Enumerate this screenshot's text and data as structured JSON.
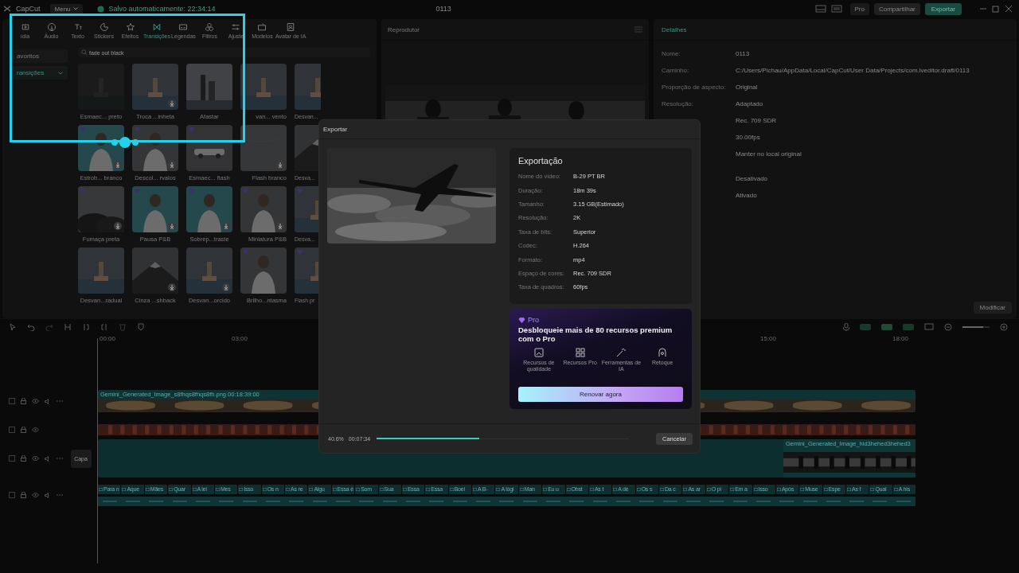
{
  "app": {
    "logo": "CapCut",
    "menu": "Menu",
    "autosave": "Salvo automaticamente: 22:34:14",
    "title": "0113",
    "pro": "Pro",
    "share": "Compartilhar",
    "export": "Exportar"
  },
  "media": {
    "tabs": [
      {
        "label": "ídia",
        "selected": false
      },
      {
        "label": "Áudio",
        "selected": false
      },
      {
        "label": "Texto",
        "selected": false
      },
      {
        "label": "Stickers",
        "selected": false
      },
      {
        "label": "Efeitos",
        "selected": false
      },
      {
        "label": "Transições",
        "selected": true
      },
      {
        "label": "Legendas",
        "selected": false
      },
      {
        "label": "Filtros",
        "selected": false
      },
      {
        "label": "Ajuste",
        "selected": false
      },
      {
        "label": "Modelos",
        "selected": false
      },
      {
        "label": "Avatar de IA",
        "selected": false
      }
    ],
    "sidebar": [
      {
        "label": "avoritos",
        "selected": false
      },
      {
        "label": "ransições",
        "selected": true
      }
    ],
    "search": {
      "value": "fade out black"
    },
    "items": [
      {
        "label": "Esmaec... preto",
        "pro": false,
        "download": false
      },
      {
        "label": "Troca ...inheta",
        "pro": false,
        "download": true
      },
      {
        "label": "Afastar",
        "pro": false,
        "download": false
      },
      {
        "label": "van... vento",
        "pro": false,
        "download": false
      },
      {
        "label": "Desvan...",
        "pro": false
      },
      {
        "label": "Estrob... branco",
        "pro": true,
        "download": true
      },
      {
        "label": "Descol... rvalos",
        "pro": true,
        "download": true
      },
      {
        "label": "Esmaec... flash",
        "pro": true,
        "download": false
      },
      {
        "label": "Flash branco",
        "pro": false,
        "download": true
      },
      {
        "label": "Desva...",
        "pro": false
      },
      {
        "label": "Fumaça preta",
        "pro": true,
        "download": true
      },
      {
        "label": "Pausa P&B",
        "pro": true,
        "download": true
      },
      {
        "label": "Sobrep...traste",
        "pro": true,
        "download": true
      },
      {
        "label": "Miniatura P&B",
        "pro": true,
        "download": true
      },
      {
        "label": "Desva...",
        "pro": true
      },
      {
        "label": "Desvan...radual",
        "pro": false,
        "download": false
      },
      {
        "label": "Cinza ...shback",
        "pro": false,
        "download": true
      },
      {
        "label": "Desvan...orcido",
        "pro": false,
        "download": true
      },
      {
        "label": "Brilho...ntasma",
        "pro": true,
        "download": false
      },
      {
        "label": "Flash pr",
        "pro": true
      }
    ]
  },
  "player": {
    "title": "Reprodutor"
  },
  "details": {
    "title": "Detalhes",
    "rows": [
      {
        "label": "Nome:",
        "value": "0113"
      },
      {
        "label": "Caminho:",
        "value": "C:/Users/Pichau/AppData/Local/CapCut/User Data/Projects/com.lveditor.draft/0113"
      },
      {
        "label": "Proporção de aspecto:",
        "value": "Original"
      },
      {
        "label": "Resolução:",
        "value": "Adaptado"
      },
      {
        "value": "Rec. 709 SDR"
      },
      {
        "value": "30.00fps"
      },
      {
        "value": "Manter no local original"
      },
      {
        "value": "Desativado"
      },
      {
        "value": "Ativado"
      }
    ],
    "button": "Modificar"
  },
  "timeline": {
    "ruler_start": [
      "00:00",
      "03:00"
    ],
    "ruler_end": [
      "15:00",
      "18:00"
    ],
    "zoom": {
      "level": 0.75
    },
    "tracks": [
      {
        "kind": "video",
        "clip": "Gemini_Generated_Image_s8fhqs8fhqs8fh.png",
        "duration": "00:18:39:00"
      },
      {
        "kind": "audio"
      },
      {
        "kind": "main",
        "clip": "Gemini_Generated_Image_hid3hehed3hehed3",
        "cover": "Capa"
      },
      {
        "kind": "captions",
        "captions": [
          "Para n",
          "Aque",
          "Mães",
          "Quar",
          "A lei",
          "Mes",
          "Isso",
          "Os n",
          "As re",
          "Algu",
          "Essa é",
          "Som",
          "Sua",
          "Essa",
          "Essa",
          "Boei",
          "A B-",
          "A lógi",
          "Man",
          "Eu u",
          "Obst",
          "As t",
          "A de",
          "Os s",
          "Da c",
          "As ar",
          "O pi",
          "Em a",
          "Isso",
          "Após",
          "Muse",
          "Espe",
          "As f",
          "Qual",
          "A his"
        ]
      }
    ]
  },
  "dialog": {
    "title": "Exportar",
    "heading": "Exportação",
    "rows": [
      {
        "label": "Nome do vídeo:",
        "value": "B-29 PT BR"
      },
      {
        "label": "Duração:",
        "value": "18m 39s"
      },
      {
        "label": "Tamanho:",
        "value": "3.15 GB(Estimado)"
      },
      {
        "label": "Resolução:",
        "value": "2K"
      },
      {
        "label": "Taxa de bits:",
        "value": "Superior"
      },
      {
        "label": "Codec:",
        "value": "H.264"
      },
      {
        "label": "Formato:",
        "value": "mp4"
      },
      {
        "label": "Espaço de cores:",
        "value": "Rec. 709 SDR"
      },
      {
        "label": "Taxa de quadros:",
        "value": "60fps"
      }
    ],
    "pro": {
      "badge": "Pro",
      "heading": "Desbloqueie mais de 80 recursos premium com o Pro",
      "features": [
        "Recursos de qualidade",
        "Recursos Pro",
        "Ferramentas de IA",
        "Retoque"
      ],
      "button": "Renovar agora"
    },
    "progress": {
      "percent": "40.6%",
      "elapsed": "00:07:34",
      "level": 0.406
    },
    "cancel": "Cancelar"
  }
}
